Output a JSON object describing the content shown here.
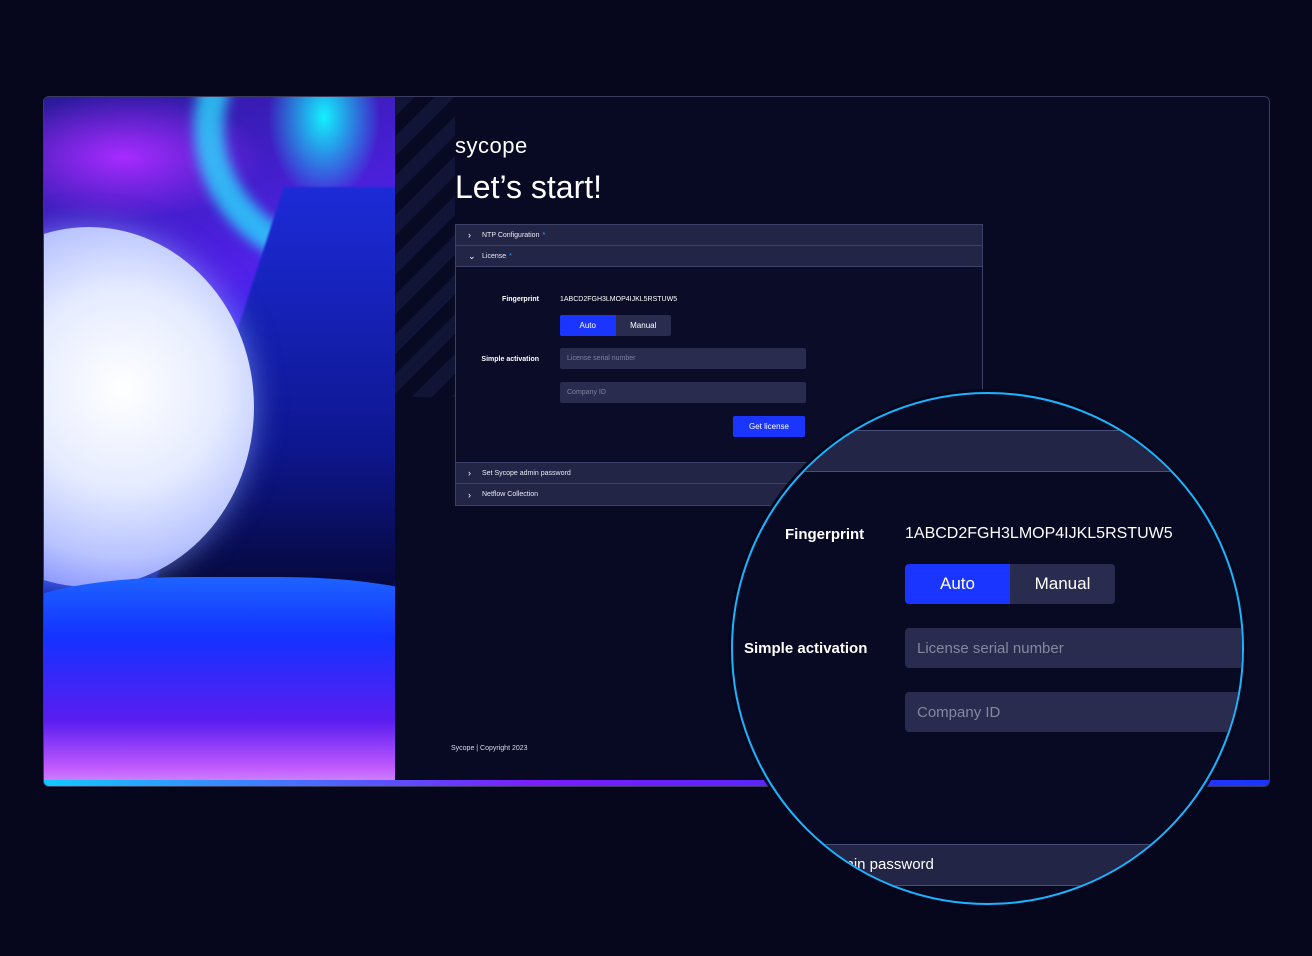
{
  "brand": {
    "logo": "sycope",
    "heading": "Let’s start!"
  },
  "accordion": {
    "sections": [
      {
        "label": "NTP Configuration",
        "required": "*"
      },
      {
        "label": "License",
        "required": "*"
      },
      {
        "label": "Set Sycope admin password"
      },
      {
        "label": "Netflow Collection"
      }
    ],
    "chevrons": {
      "collapsed": "›",
      "expanded": "⌄"
    }
  },
  "license": {
    "fingerprint_label": "Fingerprint",
    "fingerprint_value": "1ABCD2FGH3LMOP4IJKL5RSTUW5",
    "mode_options": [
      "Auto",
      "Manual"
    ],
    "selected_mode": "Auto",
    "simple_activation_label": "Simple activation",
    "serial_placeholder": "License serial number",
    "company_placeholder": "Company ID",
    "get_license_label": "Get license"
  },
  "footer": {
    "text": "Sycope  |  Copyright 2023"
  },
  "magnifier": {
    "admin_fragment": "dmin password"
  },
  "colors": {
    "accent": "#1a35ff",
    "background": "#06061c",
    "field": "#2a2c4f",
    "ring": "#1ab4ff"
  },
  "icons": [
    "chevron-right-icon",
    "chevron-down-icon"
  ]
}
